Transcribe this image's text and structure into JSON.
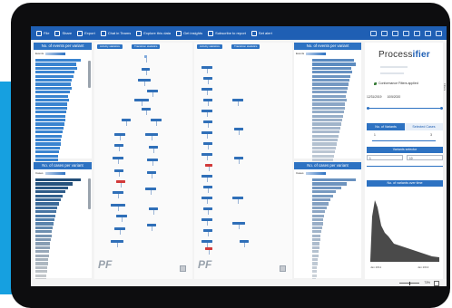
{
  "ribbon": {
    "items": [
      {
        "icon": "file-icon",
        "label": "File"
      },
      {
        "icon": "share-icon",
        "label": "Share"
      },
      {
        "icon": "export-icon",
        "label": "Export"
      },
      {
        "icon": "chat-in-teams-icon",
        "label": "Chat in Teams"
      },
      {
        "icon": "explore-data-icon",
        "label": "Explore this data"
      },
      {
        "icon": "get-insights-icon",
        "label": "Get insights"
      },
      {
        "icon": "subscribe-icon",
        "label": "Subscribe to report"
      },
      {
        "icon": "set-alert-icon",
        "label": "Set alert"
      }
    ]
  },
  "left": {
    "events_title": "No. of events per variant",
    "events_legend": "Events",
    "cases_title": "No. of cases per variant",
    "cases_legend": "Cases"
  },
  "right_charts": {
    "events_title": "No. of events per variant",
    "events_legend": "Events",
    "cases_title": "No. of cases per variant",
    "cases_legend": "Cases"
  },
  "process_map": {
    "chip_left": "Activity statistics",
    "chip_right": "Transition statistics"
  },
  "sidebar": {
    "logo_main": "Process",
    "logo_accent": "ifier",
    "filter_label": "Conformance Filters applied",
    "date_from": "12/31/2019",
    "date_to": "10/5/2020",
    "tab_variants": "No. of Variants",
    "tab_cases": "Selected Cases",
    "min_value": "1",
    "max_value": "3",
    "variants_selector": "Variants selector",
    "input_from": "1",
    "input_to": "10",
    "time_title": "No. of variants over time",
    "x_start": "Jan 2011",
    "x_end": "Jan 2013"
  },
  "filters_pane": "Filters",
  "status": {
    "zoom": "73%"
  },
  "colors": {
    "accent": "#2d72c2",
    "ribbon": "#1f5fb4",
    "strip": "#16a0e0"
  }
}
